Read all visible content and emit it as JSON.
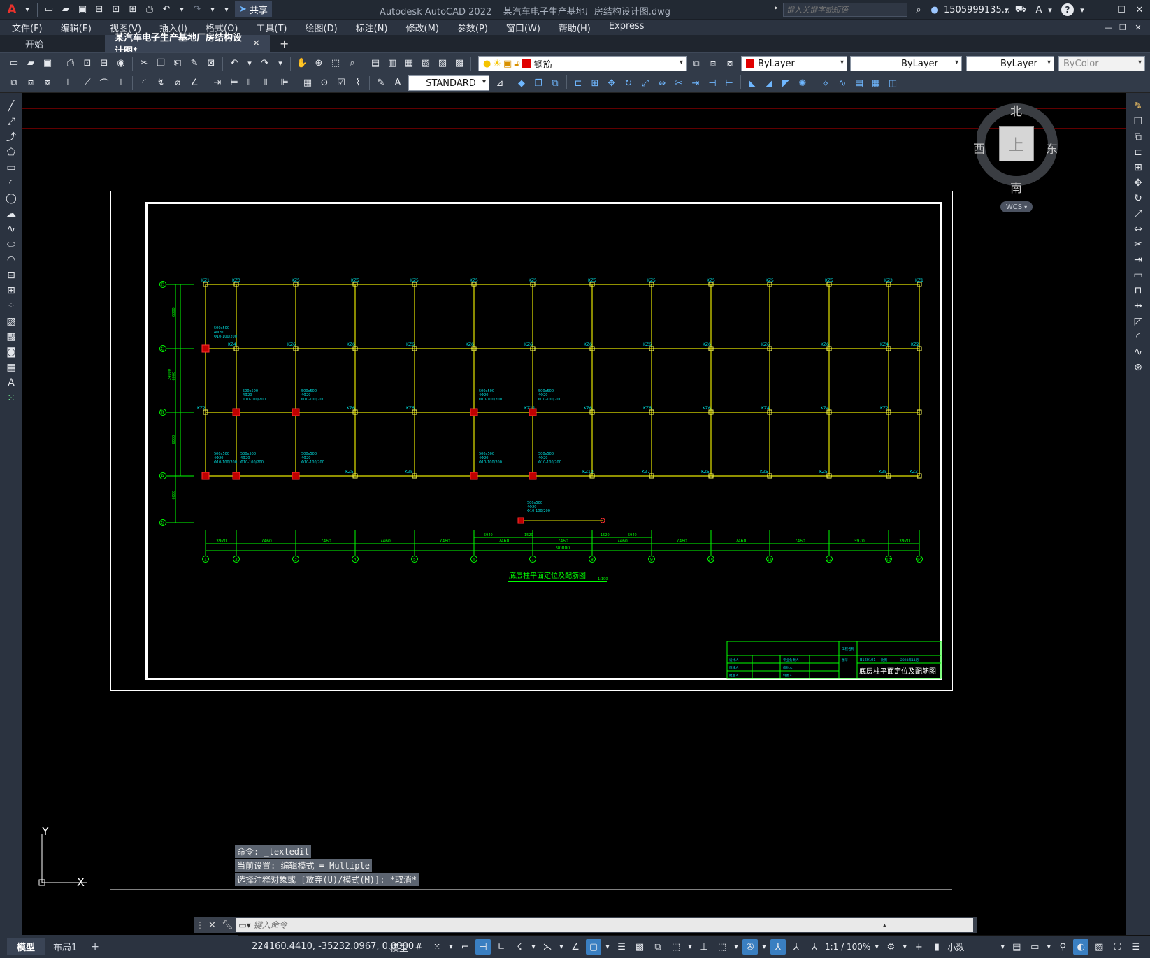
{
  "title_bar": {
    "app_logo": "A",
    "share_label": "共享",
    "app_name": "Autodesk AutoCAD 2022",
    "document_name": "某汽车电子生产基地厂房结构设计图.dwg",
    "search_placeholder": "键入关键字或短语",
    "user_name": "1505999135...",
    "help_label": "?"
  },
  "menu": [
    "文件(F)",
    "编辑(E)",
    "视图(V)",
    "插入(I)",
    "格式(O)",
    "工具(T)",
    "绘图(D)",
    "标注(N)",
    "修改(M)",
    "参数(P)",
    "窗口(W)",
    "帮助(H)",
    "Express"
  ],
  "tabs": {
    "start": "开始",
    "active": "某汽车电子生产基地厂房结构设计图*",
    "close": "✕",
    "add": "+"
  },
  "layer_dropdown": "钢筋",
  "color_dropdown": "ByLayer",
  "linetype_dropdown": "ByLayer",
  "lineweight_dropdown": "ByLayer",
  "plotstyle_dropdown": "ByColor",
  "text_style_dropdown": "STANDARD",
  "viewcube": {
    "north": "北",
    "south": "南",
    "east": "东",
    "west": "西",
    "face": "上",
    "wcs": "WCS"
  },
  "ucs": {
    "y": "Y",
    "x": "X"
  },
  "command_history": [
    "命令: _textedit",
    "当前设置: 编辑模式 = Multiple",
    "选择注释对象或 [放弃(U)/模式(M)]: *取消*"
  ],
  "command_placeholder": "键入命令",
  "layout_tabs": [
    "模型",
    "布局1"
  ],
  "layout_add": "+",
  "status": {
    "coordinates": "224160.4410, -35232.0967, 0.0000",
    "mode": "模型",
    "scale": "1:1 / 100%",
    "units": "小数"
  },
  "drawing": {
    "plan_title": "底层柱平面定位及配筋图",
    "plan_scale": "1:100",
    "total_length": "90000",
    "total_depth": "24000",
    "axis_numbers": [
      "1",
      "2",
      "3",
      "4",
      "5",
      "6",
      "7",
      "8",
      "9",
      "10",
      "11",
      "12",
      "13",
      "14"
    ],
    "axis_letters": [
      "D",
      "C",
      "B",
      "A",
      "G"
    ],
    "bay_dims": [
      "3970",
      "7460",
      "7460",
      "7460",
      "7460",
      "7460",
      "7460",
      "7460",
      "7460",
      "7460",
      "7460",
      "3970"
    ],
    "row_dims": [
      "6000",
      "6000",
      "6000",
      "6000"
    ],
    "sub_dims": [
      "5940",
      "1520",
      "1520",
      "5940"
    ],
    "column_labels_top": [
      "KZ1",
      "KZ3",
      "KZ5",
      "KZ5",
      "KZ5",
      "KZ5",
      "KZ5",
      "KZ5",
      "KZ5",
      "KZ5",
      "KZ5",
      "KZ5",
      "KZ3",
      "KZ1"
    ],
    "column_labels_c": [
      "KZ4",
      "KZ6",
      "KZ6",
      "KZ6",
      "KZ6",
      "KZ6",
      "KZ6",
      "KZ6",
      "KZ6",
      "KZ6",
      "KZ6",
      "KZ4",
      "KZ2"
    ],
    "column_labels_b": [
      "KZ2",
      "KZ6",
      "KZ6",
      "KZ11",
      "KZ6",
      "KZ6",
      "KZ6",
      "KZ4",
      "KZ4",
      "KZ2"
    ],
    "column_labels_a": [
      "KZ5",
      "KZ5",
      "KZ10",
      "KZ7",
      "KZ5",
      "KZ5",
      "KZ5",
      "KZ5",
      "KZ3",
      "KZ1"
    ],
    "annotation_lines": [
      "500x500",
      "4Φ20",
      "Φ10-100/200"
    ],
    "title_block": {
      "drawing_title": "底层柱平面定位及配筋图",
      "drawing_no": "B160101",
      "scale_label": "比例",
      "date": "2023年11月",
      "rows": [
        "设计人",
        "审核人",
        "批准人"
      ],
      "cols": [
        "专业负责人",
        "校对人",
        "制图人"
      ],
      "project_label": "工程名称",
      "figure_label": "图号"
    }
  }
}
